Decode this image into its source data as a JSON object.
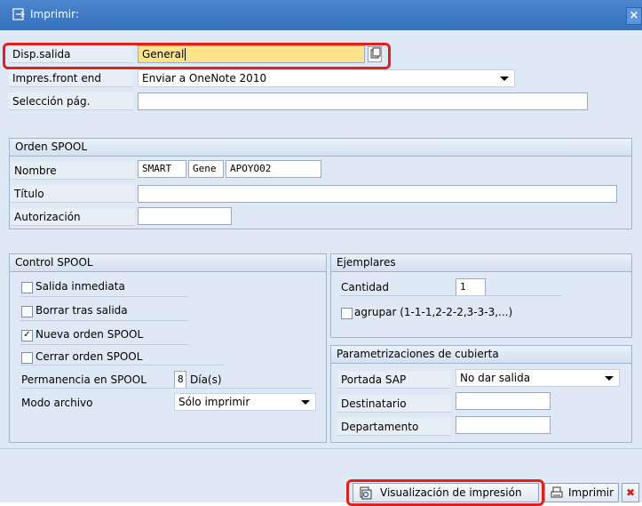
{
  "window": {
    "title": "Imprimir:",
    "close_glyph": "×"
  },
  "fields": {
    "output_device": {
      "label": "Disp.salida",
      "value": "General"
    },
    "frontend_printer": {
      "label": "Impres.front end",
      "value": "Enviar a OneNote 2010"
    },
    "page_selection": {
      "label": "Selección pág.",
      "value": ""
    }
  },
  "spool_request": {
    "title": "Orden SPOOL",
    "name_label": "Nombre",
    "name_parts": [
      "SMART",
      "Gene",
      "APOYO02"
    ],
    "title_label": "Título",
    "title_value": "",
    "authorization_label": "Autorización",
    "authorization_value": ""
  },
  "spool_control": {
    "title": "Control SPOOL",
    "options": [
      {
        "label": "Salida inmediata",
        "checked": false
      },
      {
        "label": "Borrar tras salida",
        "checked": false
      },
      {
        "label": "Nueva orden SPOOL",
        "checked": true
      },
      {
        "label": "Cerrar orden SPOOL",
        "checked": false
      }
    ],
    "retention_label": "Permanencia en SPOOL",
    "retention_value": "8",
    "retention_unit": "Día(s)",
    "archive_mode_label": "Modo archivo",
    "archive_mode_value": "Sólo imprimir"
  },
  "copies": {
    "title": "Ejemplares",
    "quantity_label": "Cantidad",
    "quantity_value": "1",
    "group_label": "agrupar (1-1-1,2-2-2,3-3-3,...)",
    "group_checked": false
  },
  "cover": {
    "title": "Parametrizaciones de cubierta",
    "sap_cover_label": "Portada SAP",
    "sap_cover_value": "No dar salida",
    "recipient_label": "Destinatario",
    "recipient_value": "",
    "department_label": "Departamento",
    "department_value": ""
  },
  "buttons": {
    "print_preview": "Visualización de impresión",
    "print": "Imprimir",
    "cancel_glyph": "✖"
  },
  "colors": {
    "highlight": "#e0201a",
    "input_focus": "#fbe38a",
    "titlebar": "#3d7bc8"
  }
}
